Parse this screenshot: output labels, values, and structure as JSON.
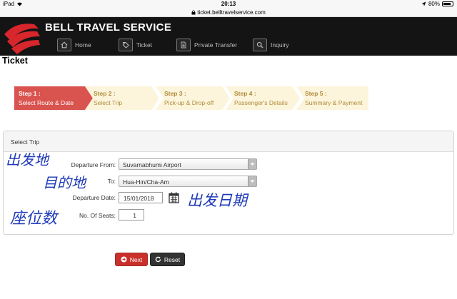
{
  "status_bar": {
    "device": "iPad",
    "time": "20:13",
    "battery": "80%",
    "battery_level": 0.8
  },
  "url": "ticket.belltravelservice.com",
  "header": {
    "brand": "BELL TRAVEL SERVICE",
    "nav": [
      {
        "label": "Home",
        "icon": "home-icon"
      },
      {
        "label": "Ticket",
        "icon": "tag-icon"
      },
      {
        "label": "Private Transfer",
        "icon": "document-icon"
      },
      {
        "label": "Inquiry",
        "icon": "search-icon"
      }
    ]
  },
  "page_title": "Ticket",
  "steps": [
    {
      "num": "Step 1 :",
      "label": "Select Route & Date",
      "active": true
    },
    {
      "num": "Step 2 :",
      "label": "Select Trip",
      "active": false
    },
    {
      "num": "Step 3 :",
      "label": "Pick-up & Drop-off",
      "active": false
    },
    {
      "num": "Step 4 :",
      "label": "Passenger's Details",
      "active": false
    },
    {
      "num": "Step 5 :",
      "label": "Summary & Payment",
      "active": false
    }
  ],
  "panel": {
    "title": "Select Trip",
    "departure_from": {
      "label": "Departure From:",
      "value": "Suvarnabhumi Airport"
    },
    "to": {
      "label": "To:",
      "value": "Hua-Hin/Cha-Am"
    },
    "departure_date": {
      "label": "Departure Date:",
      "value": "15/01/2018"
    },
    "seats": {
      "label": "No. Of Seats:",
      "value": "1"
    }
  },
  "handwriting": {
    "departure": "出发地",
    "destination": "目的地",
    "date": "出发日期",
    "seats": "座位数"
  },
  "buttons": {
    "next": "Next",
    "reset": "Reset"
  },
  "colors": {
    "active_step": "#d9534f",
    "inactive_step": "#fcf5dc",
    "handwriting": "#1d39b8",
    "next_button": "#c9302c",
    "reset_button": "#333333"
  }
}
